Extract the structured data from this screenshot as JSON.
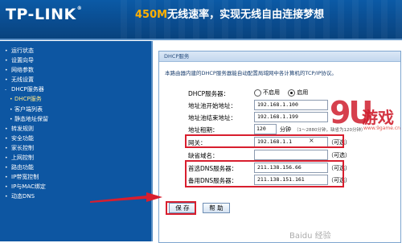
{
  "banner": {
    "brand": "TP-LINK",
    "brand_mark": "®",
    "slogan_speed": "450M",
    "slogan_text": "无线速率，实现无线自由连接梦想"
  },
  "sidebar": {
    "items": [
      {
        "label": "运行状态",
        "sub": false
      },
      {
        "label": "设置向导",
        "sub": false
      },
      {
        "label": "网络参数",
        "sub": false
      },
      {
        "label": "无线设置",
        "sub": false
      },
      {
        "label": "DHCP服务器",
        "sub": false,
        "prefix": "-"
      },
      {
        "label": "DHCP服务",
        "sub": true,
        "current": true
      },
      {
        "label": "客户端列表",
        "sub": true
      },
      {
        "label": "静态地址保留",
        "sub": true
      },
      {
        "label": "转发规则",
        "sub": false
      },
      {
        "label": "安全功能",
        "sub": false
      },
      {
        "label": "家长控制",
        "sub": false
      },
      {
        "label": "上网控制",
        "sub": false
      },
      {
        "label": "路由功能",
        "sub": false
      },
      {
        "label": "IP带宽控制",
        "sub": false
      },
      {
        "label": "IP与MAC绑定",
        "sub": false
      },
      {
        "label": "动态DNS",
        "sub": false
      }
    ]
  },
  "panel": {
    "title": "DHCP服务",
    "description": "本路由器内建的DHCP服务器能自动配置局域网中各计算机的TCP/IP协议。",
    "dhcp_server_label": "DHCP服务器：",
    "opt_disable": "不启用",
    "opt_enable": "启用",
    "enabled": true,
    "start_label": "地址池开始地址：",
    "start_value": "192.168.1.100",
    "end_label": "地址池结束地址：",
    "end_value": "192.168.1.199",
    "lease_label": "地址租期：",
    "lease_value": "120",
    "lease_unit": "分钟",
    "lease_note": "（1～2880分钟，缺省为120分钟）",
    "gateway_label": "网关：",
    "gateway_value": "192.168.1.1",
    "gateway_hint": "（可选）",
    "domain_label": "缺省域名：",
    "domain_value": "",
    "domain_hint": "（可选）",
    "dns1_label": "首选DNS服务器：",
    "dns1_value": "211.138.156.66",
    "dns1_hint": "（可选）",
    "dns2_label": "备用DNS服务器：",
    "dns2_value": "211.138.151.161",
    "dns2_hint": "（可选）",
    "save": "保 存",
    "help": "帮 助"
  },
  "watermark": {
    "logo": "9U",
    "cn": "游戏",
    "url": "www.9game.cn",
    "baidu": "Baidu 经验"
  },
  "colors": {
    "banner": "#0b5aa6",
    "sidebar": "#0d56a2",
    "highlight": "#d81e2e",
    "slogan_accent": "#ffb000"
  }
}
